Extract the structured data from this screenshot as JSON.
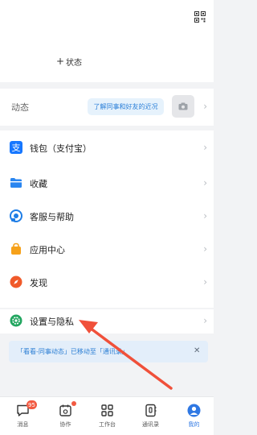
{
  "top": {
    "status_label": "状态"
  },
  "dynamics": {
    "label": "动态",
    "hint": "了解同事和好友的近况"
  },
  "menu": {
    "items": [
      {
        "label": "钱包（支付宝）",
        "icon": "alipay-icon"
      },
      {
        "label": "收藏",
        "icon": "folder-icon"
      },
      {
        "label": "客服与帮助",
        "icon": "headset-icon"
      },
      {
        "label": "应用中心",
        "icon": "shopping-bag-icon"
      },
      {
        "label": "发现",
        "icon": "compass-icon"
      }
    ]
  },
  "settings": {
    "label": "设置与隐私",
    "icon": "gear-icon"
  },
  "notice": {
    "text": "「看看-同事动态」已移动至「通讯录」"
  },
  "tabbar": {
    "items": [
      {
        "label": "消息",
        "badge": "95"
      },
      {
        "label": "协作"
      },
      {
        "label": "工作台"
      },
      {
        "label": "通讯录"
      },
      {
        "label": "我的"
      }
    ]
  },
  "colors": {
    "accent": "#2f78e3",
    "badge": "#f25a42",
    "arrow": "#f0503a"
  }
}
